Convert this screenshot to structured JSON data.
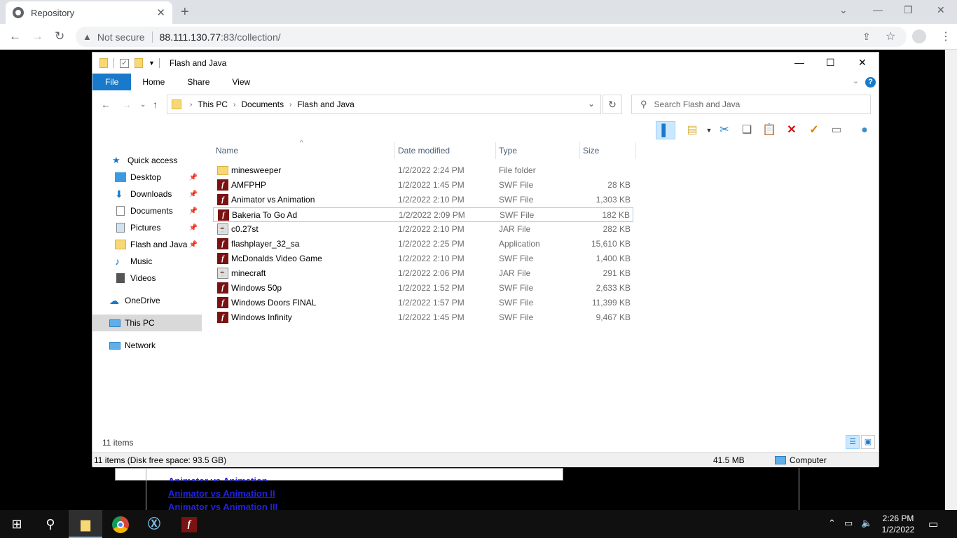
{
  "browser": {
    "tab_title": "Repository",
    "new_tab": "+",
    "not_secure": "Not secure",
    "url_host": "88.111.130.77",
    "url_rest": ":83/collection/"
  },
  "page": {
    "links": [
      "Animator vs Animation",
      "Animator vs Animation II",
      "Animator vs Animation III"
    ]
  },
  "explorer": {
    "title": "Flash and Java",
    "ribbon_tabs": [
      "File",
      "Home",
      "Share",
      "View"
    ],
    "help": "?",
    "breadcrumb": [
      "This PC",
      "Documents",
      "Flash and Java"
    ],
    "search_placeholder": "Search Flash and Java",
    "nav": [
      {
        "label": "Quick access"
      },
      {
        "label": "Desktop",
        "pinned": true
      },
      {
        "label": "Downloads",
        "pinned": true
      },
      {
        "label": "Documents",
        "pinned": true
      },
      {
        "label": "Pictures",
        "pinned": true
      },
      {
        "label": "Flash and Java",
        "pinned": true
      },
      {
        "label": "Music"
      },
      {
        "label": "Videos"
      },
      {
        "label": "OneDrive"
      },
      {
        "label": "This PC",
        "selected": true
      },
      {
        "label": "Network"
      }
    ],
    "columns": [
      "Name",
      "Date modified",
      "Type",
      "Size"
    ],
    "files": [
      {
        "name": "minesweeper",
        "date": "1/2/2022 2:24 PM",
        "type": "File folder",
        "size": "",
        "icon": "folder-icon"
      },
      {
        "name": "AMFPHP",
        "date": "1/2/2022 1:45 PM",
        "type": "SWF File",
        "size": "28 KB",
        "icon": "swf-icon"
      },
      {
        "name": "Animator vs Animation",
        "date": "1/2/2022 2:10 PM",
        "type": "SWF File",
        "size": "1,303 KB",
        "icon": "swf-icon"
      },
      {
        "name": "Bakeria To Go Ad",
        "date": "1/2/2022 2:09 PM",
        "type": "SWF File",
        "size": "182 KB",
        "icon": "swf-icon"
      },
      {
        "name": "c0.27st",
        "date": "1/2/2022 2:10 PM",
        "type": "JAR File",
        "size": "282 KB",
        "icon": "jar-icon"
      },
      {
        "name": "flashplayer_32_sa",
        "date": "1/2/2022 2:25 PM",
        "type": "Application",
        "size": "15,610 KB",
        "icon": "flash-app-icon"
      },
      {
        "name": "McDonalds Video Game",
        "date": "1/2/2022 2:10 PM",
        "type": "SWF File",
        "size": "1,400 KB",
        "icon": "swf-icon"
      },
      {
        "name": "minecraft",
        "date": "1/2/2022 2:06 PM",
        "type": "JAR File",
        "size": "291 KB",
        "icon": "jar-icon"
      },
      {
        "name": "Windows 50p",
        "date": "1/2/2022 1:52 PM",
        "type": "SWF File",
        "size": "2,633 KB",
        "icon": "swf-icon"
      },
      {
        "name": "Windows Doors FINAL",
        "date": "1/2/2022 1:57 PM",
        "type": "SWF File",
        "size": "11,399 KB",
        "icon": "swf-icon"
      },
      {
        "name": "Windows Infinity",
        "date": "1/2/2022 1:45 PM",
        "type": "SWF File",
        "size": "9,467 KB",
        "icon": "swf-icon"
      }
    ],
    "focused_file": "Bakeria To Go Ad",
    "item_count": "11 items",
    "status_left": "11 items (Disk free space: 93.5 GB)",
    "status_size": "41.5 MB",
    "status_location": "Computer"
  },
  "taskbar": {
    "time": "2:26 PM",
    "date": "1/2/2022"
  }
}
